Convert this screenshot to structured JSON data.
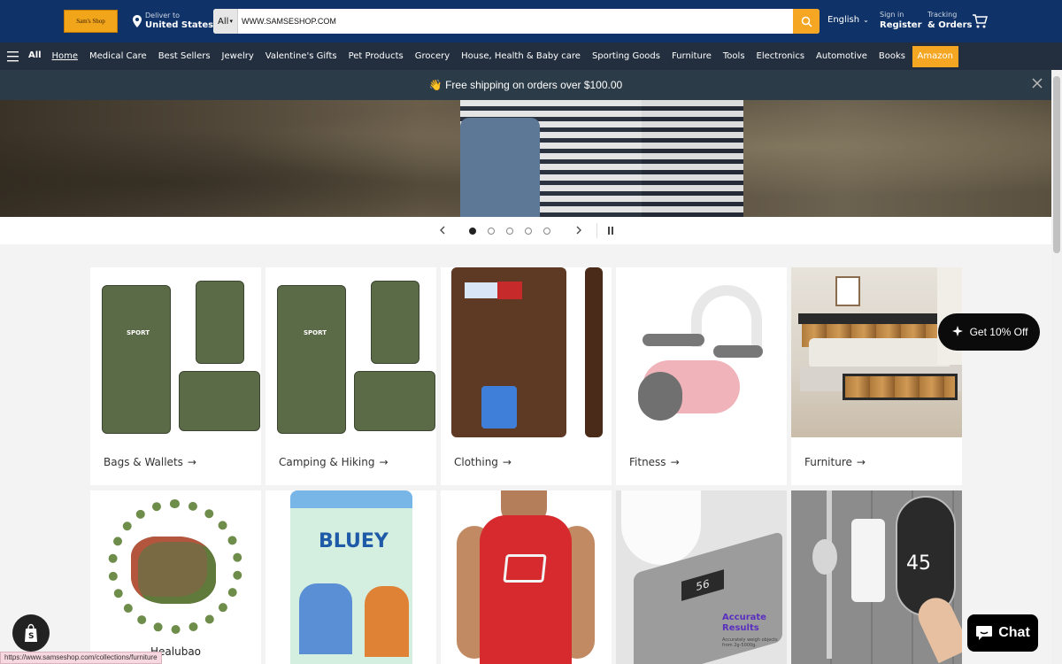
{
  "header": {
    "logo_text": "Sam's Shop",
    "deliver_small": "Deliver to",
    "deliver_big": "United States",
    "search_scope": "All",
    "search_value": "WWW.SAMSESHOP.COM",
    "language": "English",
    "signin_small": "Sign in",
    "signin_big": "Register",
    "tracking_small": "Tracking",
    "tracking_big": "& Orders"
  },
  "nav": {
    "all_label": "All",
    "items": [
      "Home",
      "Medical Care",
      "Best Sellers",
      "Jewelry",
      "Valentine's Gifts",
      "Pet Products",
      "Grocery",
      "House, Health & Baby care",
      "Sporting Goods",
      "Furniture",
      "Tools",
      "Electronics",
      "Automotive",
      "Books",
      "Amazon"
    ]
  },
  "announcement": {
    "text": "👋 Free shipping on orders over $100.00"
  },
  "carousel": {
    "slide_count": 5,
    "active_slide": 1
  },
  "categories": [
    {
      "label": "Bags & Wallets"
    },
    {
      "label": "Camping & Hiking"
    },
    {
      "label": "Clothing"
    },
    {
      "label": "Fitness"
    },
    {
      "label": "Furniture"
    }
  ],
  "second_row": {
    "partial_label": "Healubao",
    "bottle_brand": "BLUEY",
    "scale_display": "56",
    "scale_caption_title": "Accurate Results",
    "scale_caption_sub": "Accurately weigh objects from 2g-5000g.",
    "heater_display": "45"
  },
  "widgets": {
    "discount": "Get 10% Off",
    "chat": "Chat"
  },
  "status_url": "https://www.samseshop.com/collections/furniture",
  "colors": {
    "header_bg": "#0f3368",
    "nav_bg": "#232f3e",
    "accent": "#f5a623",
    "announcement_bg": "#2b3b47"
  }
}
